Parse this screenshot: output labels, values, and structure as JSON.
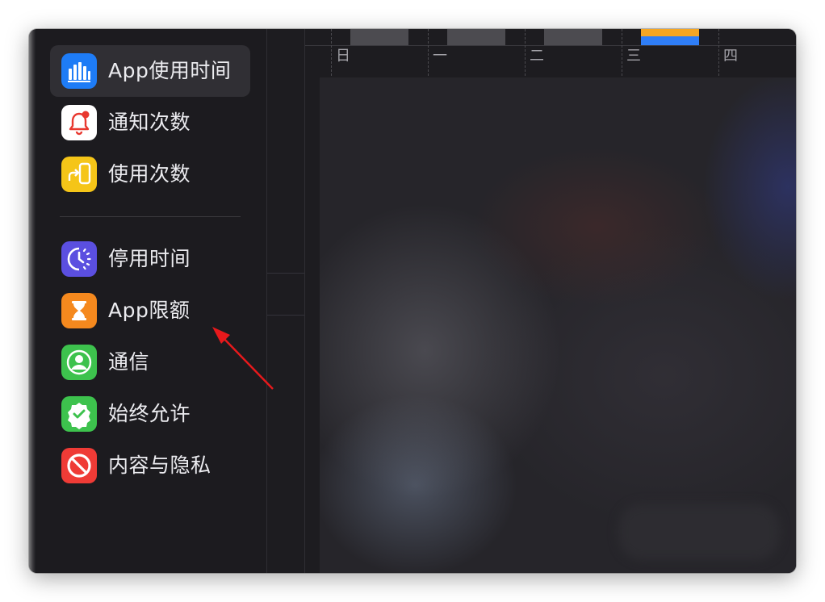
{
  "sidebar": {
    "items": [
      {
        "label": "App使用时间",
        "icon": "bar-chart-icon",
        "color": "#1e7cf6",
        "active": true
      },
      {
        "label": "通知次数",
        "icon": "bell-icon",
        "color": "#ffffff"
      },
      {
        "label": "使用次数",
        "icon": "phone-pickup-icon",
        "color": "#f5c518"
      },
      {
        "label": "停用时间",
        "icon": "moon-clock-icon",
        "color": "#5b4fe0"
      },
      {
        "label": "App限额",
        "icon": "hourglass-icon",
        "color": "#f5891e"
      },
      {
        "label": "通信",
        "icon": "person-icon",
        "color": "#3dc24d"
      },
      {
        "label": "始终允许",
        "icon": "checkmark-seal-icon",
        "color": "#3dc24d"
      },
      {
        "label": "内容与隐私",
        "icon": "restricted-icon",
        "color": "#ef3b36"
      }
    ]
  },
  "chart": {
    "day_labels": [
      "日",
      "一",
      "二",
      "三",
      "四"
    ],
    "current_day": "三",
    "bar_colors": {
      "default": "#4c4b50",
      "current_top": "#f5a623",
      "current_bottom": "#2f7ef7"
    }
  },
  "annotation": {
    "arrow_color": "#e8191c"
  }
}
